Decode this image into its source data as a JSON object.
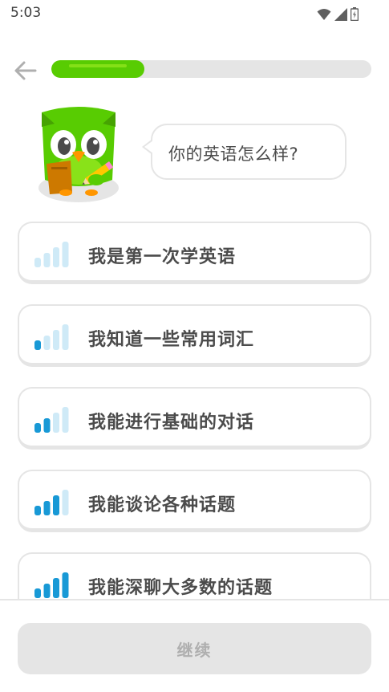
{
  "status_bar": {
    "time": "5:03"
  },
  "header": {
    "progress_fraction": 0.29
  },
  "prompt": {
    "question": "你的英语怎么样?"
  },
  "options": [
    {
      "label": "我是第一次学英语",
      "level": 0
    },
    {
      "label": "我知道一些常用词汇",
      "level": 1
    },
    {
      "label": "我能进行基础的对话",
      "level": 2
    },
    {
      "label": "我能谈论各种话题",
      "level": 3
    },
    {
      "label": "我能深聊大多数的话题",
      "level": 4
    }
  ],
  "footer": {
    "continue_label": "继续"
  },
  "colors": {
    "progress": "#58cc02",
    "bar_active": "#1cb0f6",
    "bar_active_dark": "#1899d6",
    "bar_inactive": "#cfeaf7",
    "text": "#4b4b4b",
    "border": "#e5e5e5"
  },
  "icons": [
    "wifi-icon",
    "signal-icon",
    "battery-icon",
    "back-arrow-icon",
    "duo-owl-mascot",
    "signal-level-icon"
  ]
}
